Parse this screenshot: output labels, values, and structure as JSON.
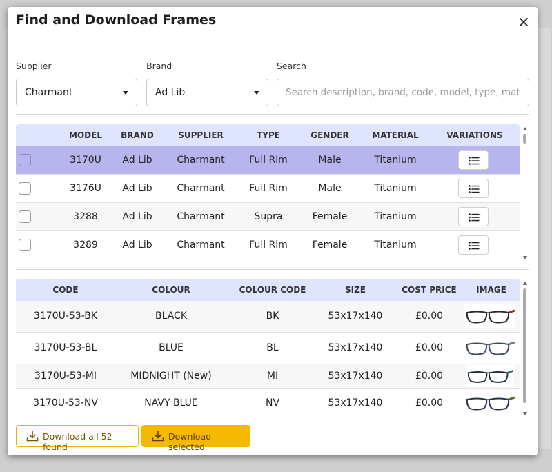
{
  "modal": {
    "title": "Find and Download Frames"
  },
  "filters": {
    "supplier_label": "Supplier",
    "supplier_value": "Charmant",
    "brand_label": "Brand",
    "brand_value": "Ad Lib",
    "search_label": "Search",
    "search_placeholder": "Search description, brand, code, model, type, material..."
  },
  "models": {
    "columns": [
      "MODEL",
      "BRAND",
      "SUPPLIER",
      "TYPE",
      "GENDER",
      "MATERIAL",
      "VARIATIONS"
    ],
    "rows": [
      {
        "model": "3170U",
        "brand": "Ad Lib",
        "supplier": "Charmant",
        "type": "Full Rim",
        "gender": "Male",
        "material": "Titanium",
        "selected": true
      },
      {
        "model": "3176U",
        "brand": "Ad Lib",
        "supplier": "Charmant",
        "type": "Full Rim",
        "gender": "Male",
        "material": "Titanium",
        "selected": false
      },
      {
        "model": "3288",
        "brand": "Ad Lib",
        "supplier": "Charmant",
        "type": "Supra",
        "gender": "Female",
        "material": "Titanium",
        "selected": false
      },
      {
        "model": "3289",
        "brand": "Ad Lib",
        "supplier": "Charmant",
        "type": "Full Rim",
        "gender": "Female",
        "material": "Titanium",
        "selected": false
      }
    ]
  },
  "variations": {
    "columns": [
      "CODE",
      "COLOUR",
      "COLOUR CODE",
      "SIZE",
      "COST PRICE",
      "IMAGE"
    ],
    "rows": [
      {
        "code": "3170U-53-BK",
        "colour": "BLACK",
        "colour_code": "BK",
        "size": "53x17x140",
        "cost": "£0.00",
        "frame_color": "#2a2a2a",
        "temple_color": "#8b2e1f"
      },
      {
        "code": "3170U-53-BL",
        "colour": "BLUE",
        "colour_code": "BL",
        "size": "53x17x140",
        "cost": "£0.00",
        "frame_color": "#3f4a58",
        "temple_color": "#6d7b8a"
      },
      {
        "code": "3170U-53-MI",
        "colour": "MIDNIGHT (New)",
        "colour_code": "MI",
        "size": "53x17x140",
        "cost": "£0.00",
        "frame_color": "#1e2a3a",
        "temple_color": "#2c6e73"
      },
      {
        "code": "3170U-53-NV",
        "colour": "NAVY BLUE",
        "colour_code": "NV",
        "size": "53x17x140",
        "cost": "£0.00",
        "frame_color": "#2b3246",
        "temple_color": "#5a6b3c"
      }
    ]
  },
  "actions": {
    "download_all": "Download all 52 found",
    "download_selected": "Download selected"
  },
  "colors": {
    "accent": "#f7b900",
    "header_bg": "#dfe5ff",
    "selected_row": "#b8b4ee"
  },
  "icons": {
    "close": "close-icon",
    "list": "list-icon",
    "download": "download-icon",
    "dropdown": "chevron-down-icon"
  }
}
